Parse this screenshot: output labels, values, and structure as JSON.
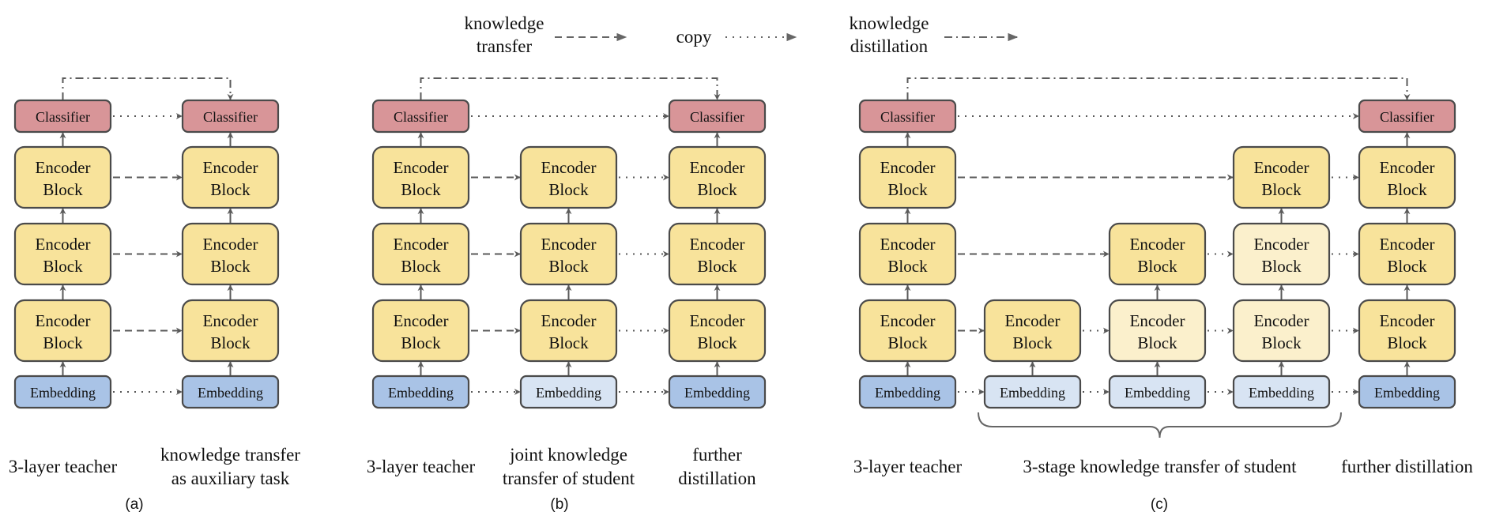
{
  "colors": {
    "classifier": "#d89598",
    "encoder": "#f8e39b",
    "encoder_light": "#fbf0cc",
    "embedding": "#a9c3e6",
    "embedding_light": "#d8e4f3",
    "stroke": "#4a4a4a",
    "arrow": "#5a5a5a"
  },
  "labels": {
    "classifier": "Classifier",
    "encoder_line1": "Encoder",
    "encoder_line2": "Block",
    "embedding": "Embedding"
  },
  "legend": [
    {
      "id": "knowledge-transfer",
      "lines": [
        "knowledge",
        "transfer"
      ],
      "style": "dashed"
    },
    {
      "id": "copy",
      "lines": [
        "copy"
      ],
      "style": "dotted"
    },
    {
      "id": "knowledge-distillation",
      "lines": [
        "knowledge",
        "distillation"
      ],
      "style": "dashdot"
    }
  ],
  "panels": [
    {
      "id": "a",
      "label": "(a)",
      "columns": [
        {
          "id": "teacher",
          "caption": [
            "3-layer teacher"
          ],
          "classifier": true,
          "encoders": [
            "full",
            "full",
            "full"
          ],
          "embedding": "full"
        },
        {
          "id": "student",
          "caption": [
            "knowledge transfer",
            "as auxiliary task"
          ],
          "classifier": true,
          "encoders": [
            "full",
            "full",
            "full"
          ],
          "embedding": "full"
        }
      ],
      "links": [
        {
          "from": "teacher.classifier",
          "to": "student.classifier",
          "style": "dotted"
        },
        {
          "from": "teacher.enc0",
          "to": "student.enc0",
          "style": "dashed"
        },
        {
          "from": "teacher.enc1",
          "to": "student.enc1",
          "style": "dashed"
        },
        {
          "from": "teacher.enc2",
          "to": "student.enc2",
          "style": "dashed"
        },
        {
          "from": "teacher.embedding",
          "to": "student.embedding",
          "style": "dotted"
        },
        {
          "from": "teacher.classifier",
          "to": "student.classifier",
          "style": "dashdot-top"
        }
      ]
    },
    {
      "id": "b",
      "label": "(b)",
      "columns": [
        {
          "id": "teacher",
          "caption": [
            "3-layer teacher"
          ],
          "classifier": true,
          "encoders": [
            "full",
            "full",
            "full"
          ],
          "embedding": "full"
        },
        {
          "id": "student",
          "caption": [
            "joint knowledge",
            "transfer of student"
          ],
          "classifier": false,
          "encoders": [
            "full",
            "full",
            "full"
          ],
          "embedding": "light"
        },
        {
          "id": "further",
          "caption": [
            "further",
            "distillation"
          ],
          "classifier": true,
          "encoders": [
            "full",
            "full",
            "full"
          ],
          "embedding": "full"
        }
      ],
      "links": [
        {
          "from": "teacher.classifier",
          "to": "further.classifier",
          "style": "dotted"
        },
        {
          "from": "teacher.enc0",
          "to": "student.enc0",
          "style": "dashed"
        },
        {
          "from": "teacher.enc1",
          "to": "student.enc1",
          "style": "dashed"
        },
        {
          "from": "teacher.enc2",
          "to": "student.enc2",
          "style": "dashed"
        },
        {
          "from": "teacher.embedding",
          "to": "student.embedding",
          "style": "dotted"
        },
        {
          "from": "student.enc0",
          "to": "further.enc0",
          "style": "dotted"
        },
        {
          "from": "student.enc1",
          "to": "further.enc1",
          "style": "dotted"
        },
        {
          "from": "student.enc2",
          "to": "further.enc2",
          "style": "dotted"
        },
        {
          "from": "student.embedding",
          "to": "further.embedding",
          "style": "dotted"
        },
        {
          "from": "teacher.classifier",
          "to": "further.classifier",
          "style": "dashdot-top"
        }
      ]
    },
    {
      "id": "c",
      "label": "(c)",
      "brace_caption": [
        "3-stage knowledge transfer of student"
      ],
      "columns": [
        {
          "id": "teacher",
          "caption": [
            "3-layer teacher"
          ],
          "classifier": true,
          "encoders": [
            "full",
            "full",
            "full"
          ],
          "embedding": "full"
        },
        {
          "id": "stage1",
          "caption": [],
          "classifier": false,
          "encoders": [
            null,
            null,
            "full"
          ],
          "embedding": "light"
        },
        {
          "id": "stage2",
          "caption": [],
          "classifier": false,
          "encoders": [
            null,
            "full",
            "light"
          ],
          "embedding": "light"
        },
        {
          "id": "stage3",
          "caption": [],
          "classifier": false,
          "encoders": [
            "full",
            "light",
            "light"
          ],
          "embedding": "light"
        },
        {
          "id": "further",
          "caption": [
            "further distillation"
          ],
          "classifier": true,
          "encoders": [
            "full",
            "full",
            "full"
          ],
          "embedding": "full"
        }
      ],
      "links": [
        {
          "from": "teacher.classifier",
          "to": "further.classifier",
          "style": "dotted"
        },
        {
          "from": "teacher.enc0",
          "to": "stage3.enc0",
          "style": "dashed"
        },
        {
          "from": "teacher.enc1",
          "to": "stage2.enc1",
          "style": "dashed"
        },
        {
          "from": "teacher.enc2",
          "to": "stage1.enc2",
          "style": "dashed"
        },
        {
          "from": "stage3.enc0",
          "to": "further.enc0",
          "style": "dotted"
        },
        {
          "from": "stage2.enc1",
          "to": "stage3.enc1",
          "style": "dotted"
        },
        {
          "from": "stage3.enc1",
          "to": "further.enc1",
          "style": "dotted"
        },
        {
          "from": "stage1.enc2",
          "to": "stage2.enc2",
          "style": "dotted"
        },
        {
          "from": "stage2.enc2",
          "to": "stage3.enc2",
          "style": "dotted"
        },
        {
          "from": "stage3.enc2",
          "to": "further.enc2",
          "style": "dotted"
        },
        {
          "from": "teacher.embedding",
          "to": "stage1.embedding",
          "style": "dotted"
        },
        {
          "from": "stage1.embedding",
          "to": "stage2.embedding",
          "style": "dotted"
        },
        {
          "from": "stage2.embedding",
          "to": "stage3.embedding",
          "style": "dotted"
        },
        {
          "from": "stage3.embedding",
          "to": "further.embedding",
          "style": "dotted"
        },
        {
          "from": "teacher.classifier",
          "to": "further.classifier",
          "style": "dashdot-top"
        }
      ]
    }
  ]
}
